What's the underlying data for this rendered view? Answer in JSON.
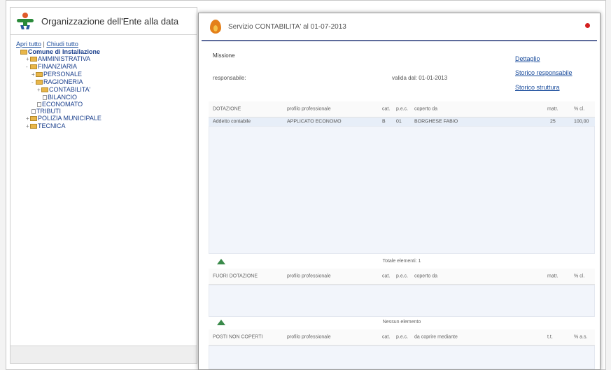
{
  "left_panel": {
    "title": "Organizzazione dell'Ente alla data",
    "open_all": "Apri tutto",
    "link_sep": "|",
    "close_all": "Chiudi tutto",
    "tree": [
      {
        "label": "Comune di Installazione",
        "level": 0,
        "prefix": "",
        "type": "folder",
        "bold": true
      },
      {
        "label": "AMMINISTRATIVA",
        "level": 1,
        "prefix": "+",
        "type": "folder",
        "bold": false
      },
      {
        "label": "FINANZIARIA",
        "level": 1,
        "prefix": "-",
        "type": "folder",
        "bold": false
      },
      {
        "label": "PERSONALE",
        "level": 2,
        "prefix": "+",
        "type": "folder",
        "bold": false
      },
      {
        "label": "RAGIONERIA",
        "level": 2,
        "prefix": "-",
        "type": "folder",
        "bold": false
      },
      {
        "label": "CONTABILITA'",
        "level": 3,
        "prefix": "+",
        "type": "folder",
        "bold": false
      },
      {
        "label": "BILANCIO",
        "level": 4,
        "prefix": "",
        "type": "doc",
        "bold": false
      },
      {
        "label": "ECONOMATO",
        "level": 3,
        "prefix": "",
        "type": "doc",
        "bold": false
      },
      {
        "label": "TRIBUTI",
        "level": 2,
        "prefix": "",
        "type": "doc",
        "bold": false
      },
      {
        "label": "POLIZIA MUNICIPALE",
        "level": 1,
        "prefix": "+",
        "type": "folder",
        "bold": false
      },
      {
        "label": "TECNICA",
        "level": 1,
        "prefix": "+",
        "type": "folder",
        "bold": false
      }
    ]
  },
  "dialog": {
    "title": "Servizio CONTABILITA' al 01-07-2013",
    "missione_label": "Missione",
    "responsabile_label": "responsabile:",
    "valido_label": "valida dal: 01-01-2013",
    "link_dettaglio": "Dettaglio",
    "link_storico_responsabile": "Storico responsabile",
    "link_storico_struttura": "Storico struttura",
    "dotazione": {
      "headers": [
        "DOTAZIONE",
        "profilo professionale",
        "cat.",
        "p.e.c.",
        "coperto da",
        "matr.",
        "% cl."
      ],
      "rows": [
        [
          "Addetto contabile",
          "APPLICATO ECONOMO",
          "B",
          "01",
          "BORGHESE FABIO",
          "25",
          "100,00"
        ]
      ],
      "total": "Totale elementi: 1"
    },
    "fuori_dotazione": {
      "headers": [
        "FUORI DOTAZIONE",
        "profilo professionale",
        "cat.",
        "p.e.c.",
        "coperto da",
        "matr.",
        "% cl."
      ],
      "total": "Nessun elemento"
    },
    "posti_non_coperti": {
      "headers": [
        "POSTI NON COPERTI",
        "profilo professionale",
        "cat.",
        "p.e.c.",
        "da coprire mediante",
        "t.t.",
        "% a.s."
      ]
    }
  },
  "colors": {
    "link": "#1a4c9c",
    "accent": "#5d6b9b",
    "row_highlight": "#e7eef8",
    "close": "#d42020"
  }
}
